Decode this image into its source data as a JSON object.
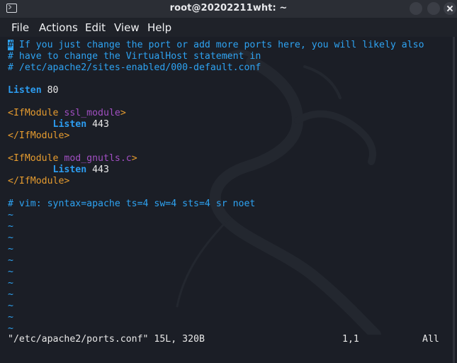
{
  "window": {
    "title": "root@20202211wht: ~"
  },
  "menu": [
    "File",
    "Actions",
    "Edit",
    "View",
    "Help"
  ],
  "editor": {
    "comment1_cursor": "#",
    "comment1_rest": " If you just change the port or add more ports here, you will likely also",
    "comment2": "# have to change the VirtualHost statement in",
    "comment3": "# /etc/apache2/sites-enabled/000-default.conf",
    "listen_keyword": "Listen",
    "listen_value": " 80",
    "block1_open_tag": "<IfModule",
    "block1_arg": "ssl_module",
    "block1_open_close": ">",
    "block1_listen_keyword": "Listen",
    "block1_listen_value": " 443",
    "block1_close_tag": "</IfModule>",
    "block2_open_tag": "<IfModule",
    "block2_arg": "mod_gnutls.c",
    "block2_open_close": ">",
    "block2_listen_keyword": "Listen",
    "block2_listen_value": " 443",
    "block2_close_tag": "</IfModule>",
    "modeline": "# vim: syntax=apache ts=4 sw=4 sts=4 sr noet",
    "tilde": "~"
  },
  "status": {
    "file_info": "\"/etc/apache2/ports.conf\" 15L, 320B",
    "position": "1,1",
    "scroll": "All"
  }
}
